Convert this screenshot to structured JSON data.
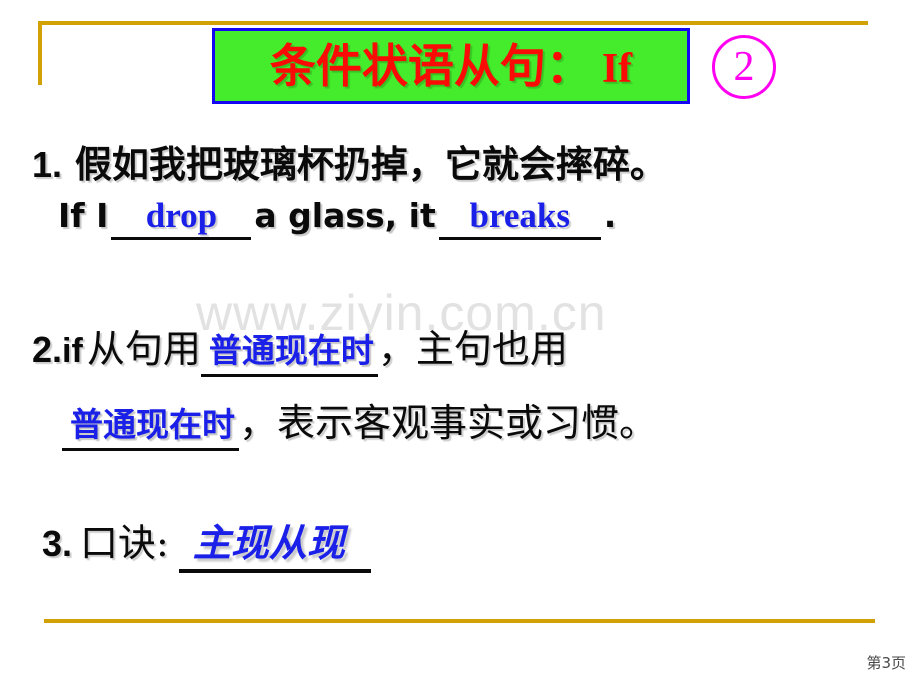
{
  "slide": {
    "background_color": "#ffffff",
    "frame_color": "#d2a106",
    "watermark": "www.ziyin.com.cn",
    "page_number": "第3页"
  },
  "title": {
    "heading_cn": "条件状语从句：",
    "heading_kw": "If",
    "badge_number": "②",
    "badge_digit": "2",
    "box_fill": "#44ec2c",
    "box_border": "#1406f2",
    "text_color": "#fb0b06",
    "badge_color": "#ff00f0"
  },
  "items": [
    {
      "number": "1.",
      "chinese": "假如我把玻璃杯扔掉，它就会摔碎。",
      "english": {
        "before": "If I",
        "blank1": "drop",
        "middle": "a glass, it",
        "blank2": "breaks",
        "after": "."
      }
    },
    {
      "number": "2.",
      "keyword": "if",
      "line1_before": "从句用",
      "line1_blank": "普通现在时",
      "line1_after": "，主句也用",
      "line2_blank": "普通现在时",
      "line2_after": "，表示客观事实或习惯。"
    },
    {
      "number": "3.",
      "label": "口诀:",
      "blank": "主现从现"
    }
  ],
  "colors": {
    "answer_blue": "#1a20e8",
    "body_black": "#0a0a0a",
    "watermark_gray": "#e2e2e2"
  }
}
